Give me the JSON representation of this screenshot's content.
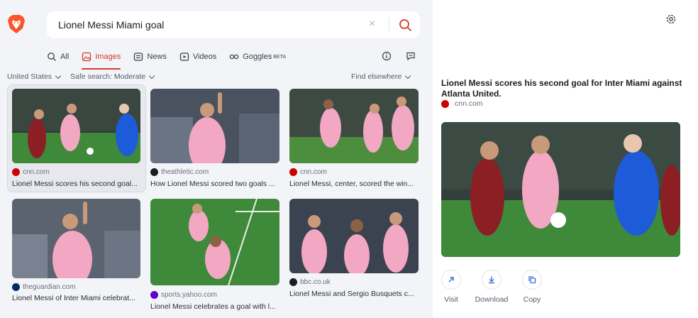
{
  "search": {
    "query": "Lionel Messi Miami goal",
    "clear_glyph": "×"
  },
  "tabs": [
    {
      "label": "All",
      "icon": "search-icon"
    },
    {
      "label": "Images",
      "icon": "image-icon",
      "active": true
    },
    {
      "label": "News",
      "icon": "news-icon"
    },
    {
      "label": "Videos",
      "icon": "video-icon"
    },
    {
      "label": "Goggles",
      "icon": "goggles-icon",
      "badge": "BETA"
    }
  ],
  "filters": {
    "region": "United States",
    "safe_search": "Safe search: Moderate",
    "find_elsewhere": "Find elsewhere"
  },
  "results": [
    {
      "source": "cnn.com",
      "caption": "Lionel Messi scores his second goal...",
      "fav_color": "#cc0000",
      "fav_text": "CNN"
    },
    {
      "source": "theathletic.com",
      "caption": "How Lionel Messi scored two goals ...",
      "fav_color": "#1b1d22",
      "fav_text": "A"
    },
    {
      "source": "cnn.com",
      "caption": "Lionel Messi, center, scored the win...",
      "fav_color": "#cc0000",
      "fav_text": "CNN"
    },
    {
      "source": "theguardian.com",
      "caption": "Lionel Messi of Inter Miami celebrat...",
      "fav_color": "#052962",
      "fav_text": "G"
    },
    {
      "source": "sports.yahoo.com",
      "caption": "Lionel Messi celebrates a goal with l...",
      "fav_color": "#6001d2",
      "fav_text": "Y"
    },
    {
      "source": "bbc.co.uk",
      "caption": "Lionel Messi and Sergio Busquets c...",
      "fav_color": "#1b1d22",
      "fav_text": "B"
    }
  ],
  "detail": {
    "title": "Lionel Messi scores his second goal for Inter Miami against Atlanta United.",
    "source": "cnn.com",
    "actions": [
      {
        "label": "Visit",
        "icon": "arrow-up-right-icon"
      },
      {
        "label": "Download",
        "icon": "download-icon"
      },
      {
        "label": "Copy",
        "icon": "copy-icon"
      }
    ]
  },
  "colors": {
    "accent": "#d33b2b",
    "panel_bg": "#f3f4f7",
    "pitch_green": "#3f8a3a",
    "inter_pink": "#f2a7c3"
  }
}
